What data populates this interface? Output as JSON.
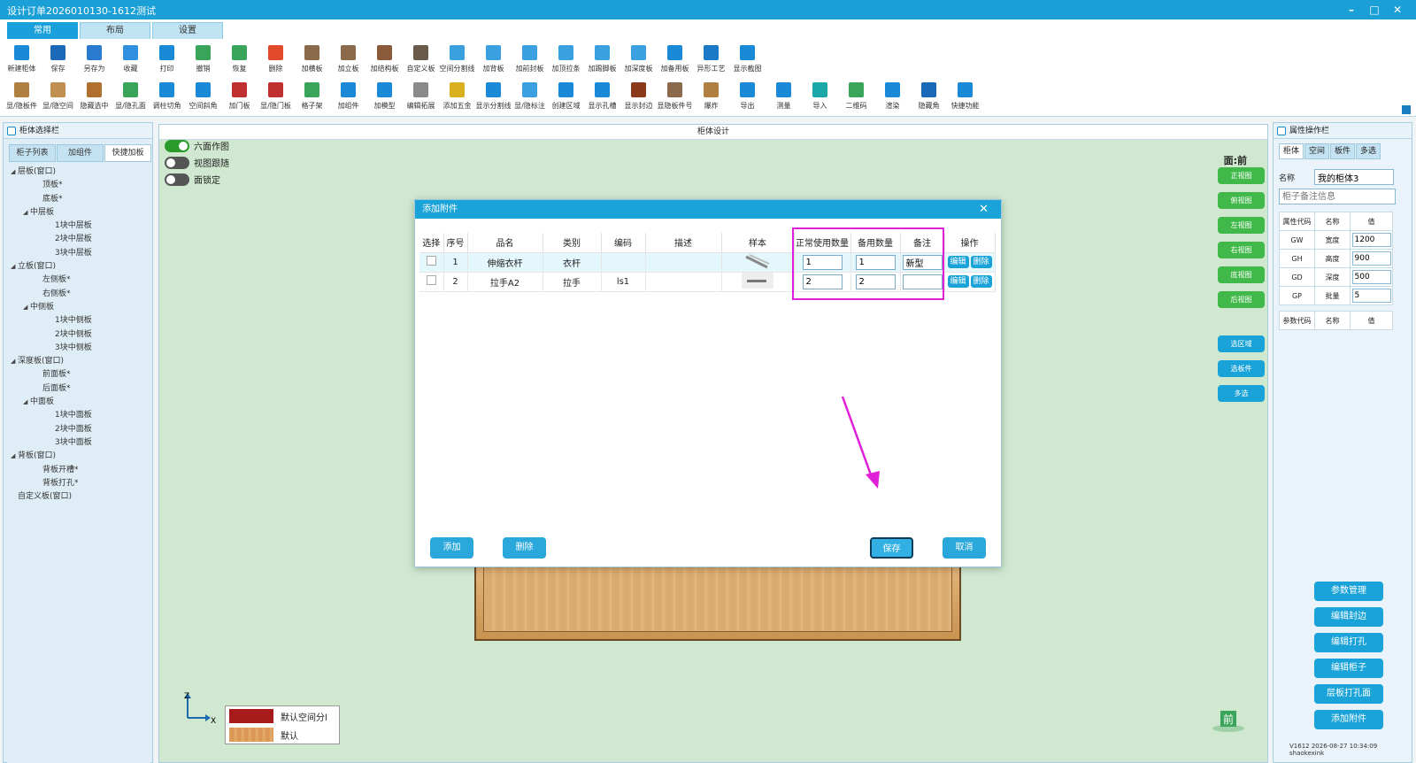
{
  "window": {
    "title": "设计订单2026010130-1612测试",
    "min": "–",
    "max": "□",
    "close": "✕"
  },
  "tabs": [
    "常用",
    "布局",
    "设置"
  ],
  "toolbar": {
    "row1": [
      "新建柜体",
      "保存",
      "另存为",
      "收藏",
      "打印",
      "撤销",
      "恢复",
      "删除",
      "加横板",
      "加立板",
      "加结构板",
      "自定义板",
      "空间分割线",
      "加背板",
      "加前封板",
      "加顶拉条",
      "加踢脚板",
      "加深度板",
      "加备用板",
      "异形工艺",
      "显示截图"
    ],
    "row2": [
      "显/隐板件",
      "显/隐空间",
      "隐藏选中",
      "显/隐孔面",
      "调柱切角",
      "空间斜角",
      "加门板",
      "显/隐门板",
      "格子架",
      "加组件",
      "加模型",
      "编辑拓展",
      "添加五金",
      "显示分割线",
      "显/隐标注",
      "创建区域",
      "显示孔槽",
      "显示封边",
      "显隐板件号",
      "爆炸",
      "导出",
      "测量",
      "导入",
      "二维码",
      "渲染",
      "隐藏角",
      "快捷功能"
    ]
  },
  "left": {
    "title": "柜体选择栏",
    "tabs": [
      "柜子列表",
      "加组件",
      "快捷加板"
    ],
    "tree": [
      {
        "label": "层板(窗口)",
        "level": 0,
        "arrow": "◢"
      },
      {
        "label": "顶板*",
        "level": 2,
        "arrow": ""
      },
      {
        "label": "底板*",
        "level": 2,
        "arrow": ""
      },
      {
        "label": "中层板",
        "level": 1,
        "arrow": "◢"
      },
      {
        "label": "1块中层板",
        "level": 3,
        "arrow": ""
      },
      {
        "label": "2块中层板",
        "level": 3,
        "arrow": ""
      },
      {
        "label": "3块中层板",
        "level": 3,
        "arrow": ""
      },
      {
        "label": "立板(窗口)",
        "level": 0,
        "arrow": "◢"
      },
      {
        "label": "左侧板*",
        "level": 2,
        "arrow": ""
      },
      {
        "label": "右侧板*",
        "level": 2,
        "arrow": ""
      },
      {
        "label": "中侧板",
        "level": 1,
        "arrow": "◢"
      },
      {
        "label": "1块中侧板",
        "level": 3,
        "arrow": ""
      },
      {
        "label": "2块中侧板",
        "level": 3,
        "arrow": ""
      },
      {
        "label": "3块中侧板",
        "level": 3,
        "arrow": ""
      },
      {
        "label": "深度板(窗口)",
        "level": 0,
        "arrow": "◢"
      },
      {
        "label": "前面板*",
        "level": 2,
        "arrow": ""
      },
      {
        "label": "后面板*",
        "level": 2,
        "arrow": ""
      },
      {
        "label": "中面板",
        "level": 1,
        "arrow": "◢"
      },
      {
        "label": "1块中面板",
        "level": 3,
        "arrow": ""
      },
      {
        "label": "2块中面板",
        "level": 3,
        "arrow": ""
      },
      {
        "label": "3块中面板",
        "level": 3,
        "arrow": ""
      },
      {
        "label": "背板(窗口)",
        "level": 0,
        "arrow": "◢"
      },
      {
        "label": "背板开槽*",
        "level": 2,
        "arrow": ""
      },
      {
        "label": "背板打孔*",
        "level": 2,
        "arrow": ""
      },
      {
        "label": "自定义板(窗口)",
        "level": 0,
        "arrow": ""
      }
    ]
  },
  "center": {
    "title": "柜体设计",
    "toggles": [
      {
        "label": "六面作图",
        "on": true
      },
      {
        "label": "视图跟随",
        "on": false
      },
      {
        "label": "面锁定",
        "on": false
      }
    ],
    "face_label": "面:前",
    "view_buttons": [
      "正视图",
      "俯视图",
      "左视图",
      "右视图",
      "底视图",
      "后视图"
    ],
    "select_buttons": [
      "选区域",
      "选板件",
      "多选"
    ],
    "axis": {
      "z": "Z",
      "x": "X"
    },
    "legend": [
      {
        "label": "默认空间分l",
        "color": "#a81b1b"
      },
      {
        "label": "默认",
        "color": "#e0a060"
      }
    ],
    "front_label": "前"
  },
  "right": {
    "title": "属性操作栏",
    "tabs": [
      "柜体",
      "空间",
      "板件",
      "多选"
    ],
    "name_label": "名称",
    "name_value": "我的柜体3",
    "note_placeholder": "柜子备注信息",
    "attr_headers": [
      "属性代码",
      "名称",
      "值"
    ],
    "attrs": [
      {
        "code": "GW",
        "name": "宽度",
        "value": "1200"
      },
      {
        "code": "GH",
        "name": "高度",
        "value": "900"
      },
      {
        "code": "GD",
        "name": "深度",
        "value": "500"
      },
      {
        "code": "GP",
        "name": "批量",
        "value": "5"
      }
    ],
    "param_headers": [
      "参数代码",
      "名称",
      "值"
    ],
    "buttons": [
      "参数管理",
      "编辑封边",
      "编辑打孔",
      "编辑柜子",
      "层板打孔面",
      "添加附件"
    ],
    "version": "V1612 2026-08-27 10:34:09 shaokexink"
  },
  "dialog": {
    "title": "添加附件",
    "close": "✕",
    "headers": [
      "选择",
      "序号",
      "品名",
      "类别",
      "编码",
      "描述",
      "样本",
      "正常使用数量",
      "备用数量",
      "备注",
      "操作"
    ],
    "rows": [
      {
        "no": "1",
        "name": "伸缩衣杆",
        "category": "衣杆",
        "code": "",
        "desc": "",
        "qty": "1",
        "spare": "1",
        "note": "新型",
        "edit": "编辑",
        "del": "删除"
      },
      {
        "no": "2",
        "name": "拉手A2",
        "category": "拉手",
        "code": "ls1",
        "desc": "",
        "qty": "2",
        "spare": "2",
        "note": "",
        "edit": "编辑",
        "del": "删除"
      }
    ],
    "buttons": {
      "add": "添加",
      "delete": "删除",
      "save": "保存",
      "cancel": "取消"
    }
  },
  "colors": {
    "accent": "#1aa3d8",
    "green": "#41b84a",
    "highlight": "#e020d8"
  }
}
